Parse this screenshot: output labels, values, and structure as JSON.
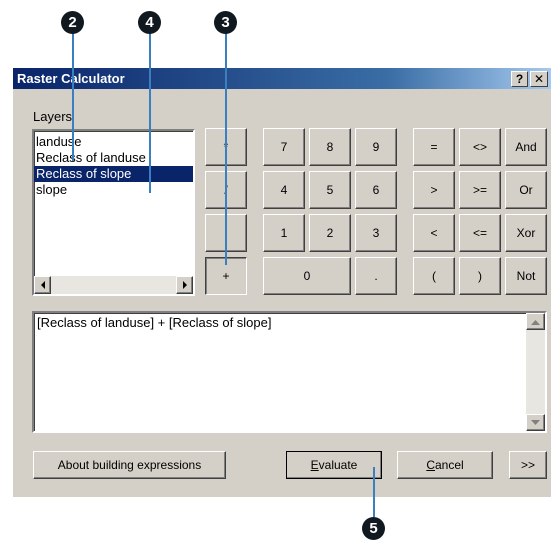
{
  "window": {
    "title": "Raster Calculator",
    "help_glyph": "?",
    "close_glyph": "✕"
  },
  "layers": {
    "label": "Layers",
    "items": [
      "landuse",
      "Reclass of landuse",
      "Reclass of slope",
      "slope"
    ],
    "selected_index": 2
  },
  "keypad": {
    "ops_left": [
      "*",
      "/",
      "",
      "+"
    ],
    "digits_row1": [
      "7",
      "8",
      "9"
    ],
    "digits_row2": [
      "4",
      "5",
      "6"
    ],
    "digits_row3": [
      "1",
      "2",
      "3"
    ],
    "zero": "0",
    "dot": ".",
    "compare_col1": [
      "=",
      ">",
      "<",
      "("
    ],
    "compare_col2": [
      "<>",
      ">=",
      "<=",
      ")"
    ],
    "logic": [
      "And",
      "Or",
      "Xor",
      "Not"
    ]
  },
  "expression": {
    "value": "[Reclass of landuse] + [Reclass of slope]"
  },
  "buttons": {
    "about": "About building expressions",
    "evaluate_key": "E",
    "evaluate_rest": "valuate",
    "cancel_key": "C",
    "cancel_rest": "ancel",
    "more": ">>"
  },
  "callouts": [
    "2",
    "4",
    "3",
    "5"
  ],
  "colors": {
    "title_start": "#0a246a",
    "title_end": "#a6caf0",
    "callout": "#101820",
    "leader": "#3a7fc0",
    "dialog_bg": "#d4d0c8"
  }
}
